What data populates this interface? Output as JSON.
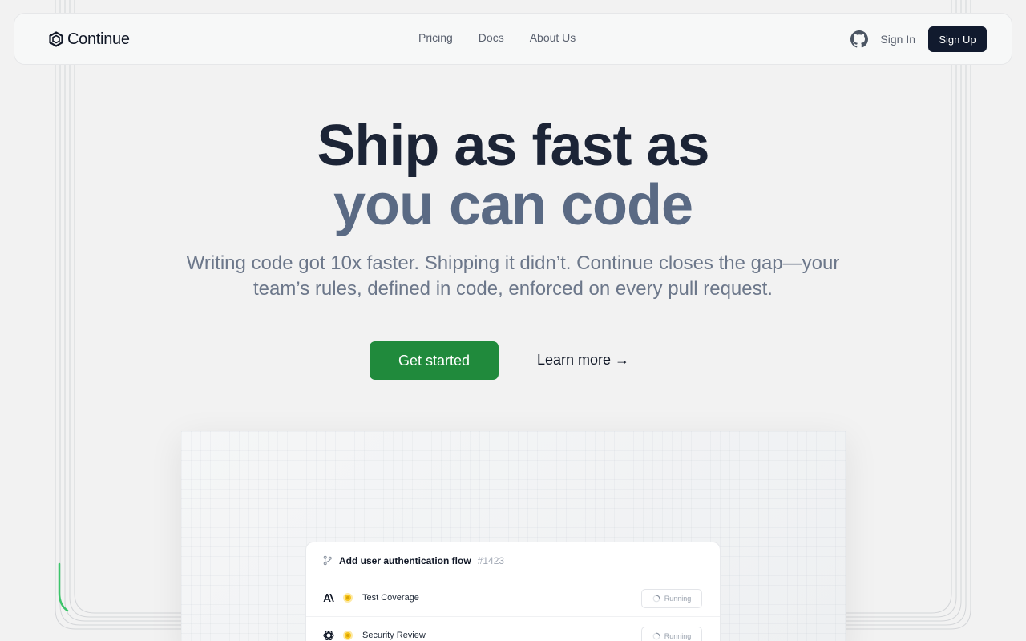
{
  "nav": {
    "brand": "Continue",
    "links": [
      "Pricing",
      "Docs",
      "About Us"
    ],
    "sign_in": "Sign In",
    "sign_up": "Sign Up"
  },
  "hero": {
    "title_line1": "Ship as fast as",
    "title_line2": "you can code",
    "subtitle": "Writing code got 10x faster. Shipping it didn’t. Continue closes the gap—your team’s rules, defined in code, enforced on every pull request.",
    "cta_primary": "Get started",
    "cta_secondary": "Learn more →"
  },
  "pull_request": {
    "title": "Add user authentication flow",
    "number": "#1423",
    "checks": [
      {
        "name": "Test Coverage",
        "status": "Running",
        "provider_icon": "anthropic-icon"
      },
      {
        "name": "Security Review",
        "status": "Running",
        "provider_icon": "openai-icon"
      }
    ]
  },
  "colors": {
    "primary_green": "#208a3c",
    "navy": "#111a2e",
    "status_yellow": "#f7c51c"
  }
}
